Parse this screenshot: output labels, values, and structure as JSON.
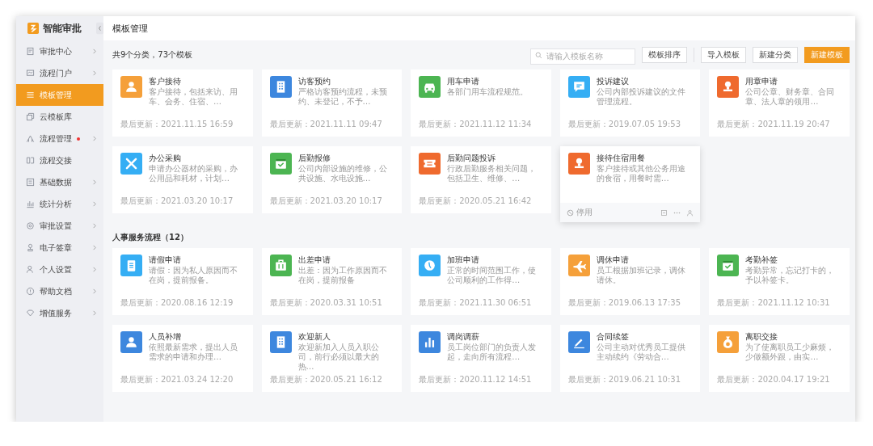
{
  "sidebar": {
    "app_name": "智能审批",
    "items": [
      {
        "label": "审批中心",
        "selected": false,
        "has_submenu": true,
        "dot": false
      },
      {
        "label": "流程门户",
        "selected": false,
        "has_submenu": true,
        "dot": false
      },
      {
        "label": "模板管理",
        "selected": true,
        "has_submenu": false,
        "dot": false
      },
      {
        "label": "云模板库",
        "selected": false,
        "has_submenu": false,
        "dot": false
      },
      {
        "label": "流程管理",
        "selected": false,
        "has_submenu": true,
        "dot": true
      },
      {
        "label": "流程交接",
        "selected": false,
        "has_submenu": false,
        "dot": false
      },
      {
        "label": "基础数据",
        "selected": false,
        "has_submenu": true,
        "dot": false
      },
      {
        "label": "统计分析",
        "selected": false,
        "has_submenu": true,
        "dot": false
      },
      {
        "label": "审批设置",
        "selected": false,
        "has_submenu": true,
        "dot": false
      },
      {
        "label": "电子签章",
        "selected": false,
        "has_submenu": true,
        "dot": false
      },
      {
        "label": "个人设置",
        "selected": false,
        "has_submenu": true,
        "dot": false
      },
      {
        "label": "帮助文档",
        "selected": false,
        "has_submenu": true,
        "dot": false
      },
      {
        "label": "增值服务",
        "selected": false,
        "has_submenu": true,
        "dot": false
      }
    ]
  },
  "page_title": "模板管理",
  "toolbar": {
    "summary": "共9个分类，73个模板",
    "search": {
      "placeholder": "请输入模板名称"
    },
    "buttons": [
      {
        "label": "模板排序",
        "primary": false
      },
      {
        "label": "导入模板",
        "primary": false
      },
      {
        "label": "新建分类",
        "primary": false
      },
      {
        "label": "新建模板",
        "primary": true
      }
    ]
  },
  "sections": [
    {
      "cards": [
        {
          "title": "客户接待",
          "description": "客户接待，包括来访、用车、会务、住宿、…",
          "updated": "最后更新：2021.11.15 16:59",
          "color": "#f5a03a",
          "hovered": false
        },
        {
          "title": "访客预约",
          "description": "严格访客预约流程，未预约、未登记，不予…",
          "updated": "最后更新：2021.11.11 09:47",
          "color": "#3d87de",
          "hovered": false
        },
        {
          "title": "用车申请",
          "description": "各部门用车流程规范。",
          "updated": "最后更新：2021.11.12 11:34",
          "color": "#4cb552",
          "hovered": false
        },
        {
          "title": "投诉建议",
          "description": "公司内部投诉建议的文件管理流程。",
          "updated": "最后更新：2019.07.05 19:53",
          "color": "#35aef4",
          "hovered": false
        },
        {
          "title": "用章申请",
          "description": "公司公章、财务章、合同章、法人章的领用…",
          "updated": "最后更新：2021.11.19 20:47",
          "color": "#ef6a2e",
          "hovered": false
        },
        {
          "title": "办公采购",
          "description": "申请办公器材的采购，办公用品和耗材，计划…",
          "updated": "最后更新：2021.03.20 10:17",
          "color": "#35aef4",
          "hovered": false
        },
        {
          "title": "后勤报修",
          "description": "公司内部设施的维修，公共设施、水电设施…",
          "updated": "最后更新：2021.03.20 10:17",
          "color": "#4cb552",
          "hovered": false
        },
        {
          "title": "后勤问题投诉",
          "description": "行政后勤服务相关问题，包括卫生、维修、…",
          "updated": "最后更新：2020.05.21 16:42",
          "color": "#ef6a2e",
          "hovered": false
        },
        {
          "title": "接待住宿用餐",
          "description": "客户接待或其他公务用途的食宿，用餐时需…",
          "action_label": "停用",
          "color": "#ef6a2e",
          "hovered": true
        }
      ]
    },
    {
      "title": "人事服务流程（12）",
      "cards": [
        {
          "title": "请假申请",
          "description": "请假：因为私人原因而不在岗，提前报备。",
          "updated": "最后更新：2020.08.16 12:19",
          "color": "#35aef4",
          "hovered": false
        },
        {
          "title": "出差申请",
          "description": "出差：因为工作原因而不在岗，提前报备",
          "updated": "最后更新：2020.03.31 10:51",
          "color": "#4cb552",
          "hovered": false
        },
        {
          "title": "加班申请",
          "description": "正常的时间范围工作，使公司顺利的工作得…",
          "updated": "最后更新：2021.11.30 06:51",
          "color": "#35aef4",
          "hovered": false
        },
        {
          "title": "调休申请",
          "description": "员工根据加班记录，调休请休。",
          "updated": "最后更新：2019.06.13 17:35",
          "color": "#f5a03a",
          "hovered": false
        },
        {
          "title": "考勤补签",
          "description": "考勤异常，忘记打卡的，予以补签卡。",
          "updated": "最后更新：2021.11.12 10:31",
          "color": "#4cb552",
          "hovered": false
        },
        {
          "title": "人员补增",
          "description": "依照最新需求，提出人员需求的申请和办理…",
          "updated": "最后更新：2021.03.24 12:20",
          "color": "#3d87de",
          "hovered": false
        },
        {
          "title": "欢迎新人",
          "description": "欢迎新加入人员入职公司，前行必须以最大的热…",
          "updated": "最后更新：2020.05.21 16:12",
          "color": "#3d87de",
          "hovered": false
        },
        {
          "title": "调岗调薪",
          "description": "员工岗位部门的负责人发起，走向所有流程…",
          "updated": "最后更新：2020.11.12 14:51",
          "color": "#3d87de",
          "hovered": false
        },
        {
          "title": "合同续签",
          "description": "公司主动对优秀员工提供主动续约《劳动合…",
          "updated": "最后更新：2019.06.21 10:31",
          "color": "#3d87de",
          "hovered": false
        },
        {
          "title": "离职交接",
          "description": "为了使离职员工少麻烦，少做额外跟，由实…",
          "updated": "最后更新：2020.04.17 19:21",
          "color": "#f5a03a",
          "hovered": false
        }
      ]
    }
  ]
}
